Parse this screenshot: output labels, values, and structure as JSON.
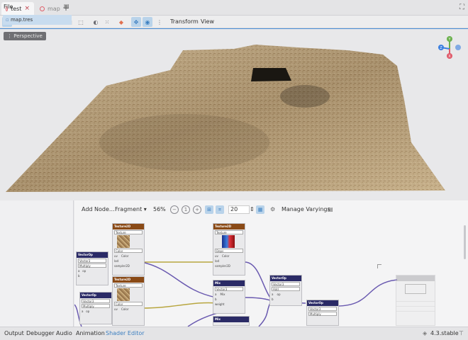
{
  "tabs": [
    {
      "label": "test",
      "close": "×"
    },
    {
      "label": "map",
      "close": ""
    }
  ],
  "add_tab": "+",
  "toolbar": {
    "menus": [
      "Transform",
      "View"
    ]
  },
  "viewport": {
    "perspective_label": "⋮ Perspective",
    "gizmo": {
      "y": "Y",
      "x": "X",
      "z": "Z"
    }
  },
  "filesystem": {
    "title": "File",
    "items": [
      "map.tres"
    ]
  },
  "shader_editor": {
    "add_node": "Add Node...",
    "mode": "Fragment",
    "zoom": "56%",
    "snap": "20",
    "manage_varyings": "Manage Varyings"
  },
  "nodes": {
    "texture2d": "Texture2D",
    "vectorop": "VectorOp",
    "mix": "Mix",
    "texture": "Texture",
    "color": "Color",
    "vector3": "Vector3",
    "multiply": "Multiply",
    "add": "Add",
    "deps": "Deps",
    "uv": "uv",
    "lod": "lod",
    "sampler2d": "sampler2D",
    "weight": "weight",
    "a": "a",
    "b": "b",
    "op": "op"
  },
  "bottom_tabs": [
    "Output",
    "Debugger",
    "Audio",
    "Animation",
    "Shader Editor"
  ],
  "version": "4.3.stable",
  "colors": {
    "accent": "#4a90d9",
    "tex_header": "#8a4a16",
    "op_header": "#2a2a66"
  }
}
